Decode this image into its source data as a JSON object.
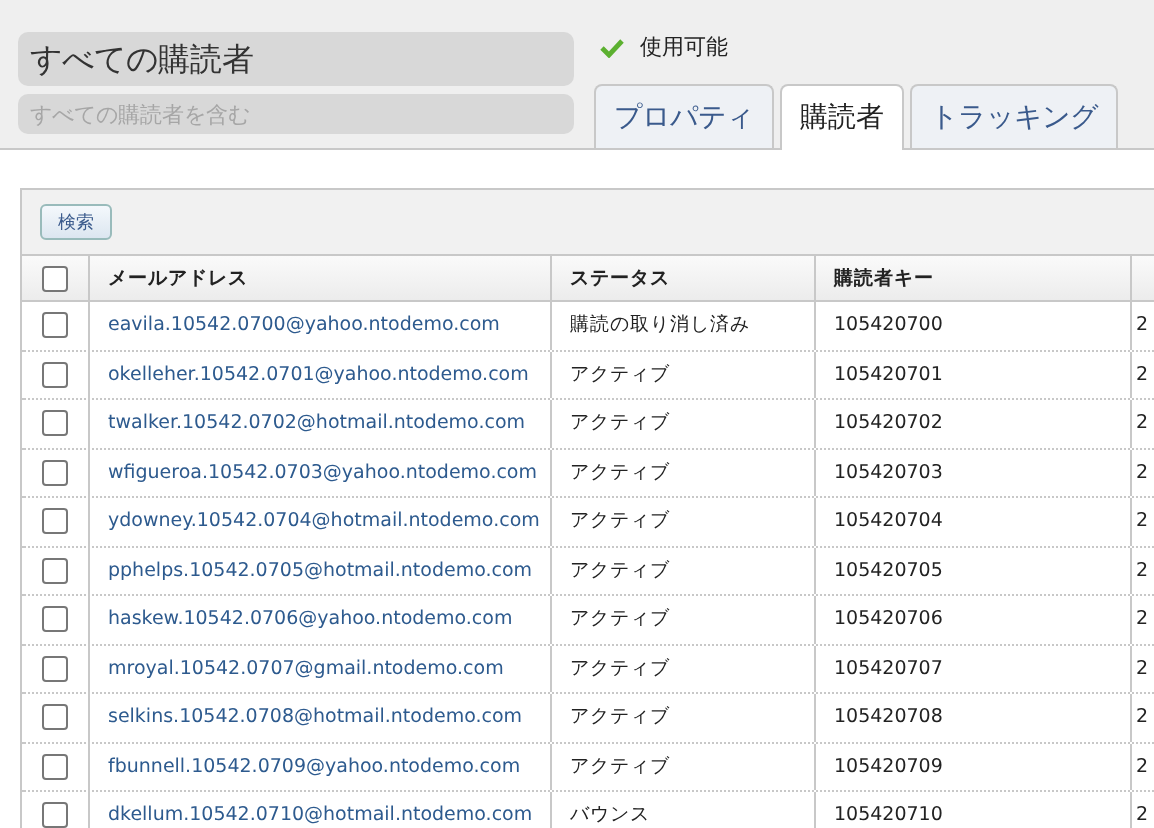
{
  "header": {
    "title": "すべての購読者",
    "description_placeholder": "すべての購読者を含む",
    "status": {
      "label": "使用可能",
      "checked": true
    }
  },
  "tabs": [
    {
      "label": "プロパティ",
      "selected": false
    },
    {
      "label": "購読者",
      "selected": true
    },
    {
      "label": "トラッキング",
      "selected": false
    }
  ],
  "toolbar": {
    "search_button": "検索"
  },
  "table": {
    "select_all": {
      "checked": false
    },
    "columns": [
      "メールアドレス",
      "ステータス",
      "購読者キー"
    ],
    "rows": [
      {
        "checked": false,
        "email": "eavila.10542.0700@yahoo.ntodemo.com",
        "status": "購読の取り消し済み",
        "key": "105420700",
        "column_5": "2"
      },
      {
        "checked": false,
        "email": "okelleher.10542.0701@yahoo.ntodemo.com",
        "status": "アクティブ",
        "key": "105420701",
        "column_5": "2"
      },
      {
        "checked": false,
        "email": "twalker.10542.0702@hotmail.ntodemo.com",
        "status": "アクティブ",
        "key": "105420702",
        "column_5": "2"
      },
      {
        "checked": false,
        "email": "wfigueroa.10542.0703@yahoo.ntodemo.com",
        "status": "アクティブ",
        "key": "105420703",
        "column_5": "2"
      },
      {
        "checked": false,
        "email": "ydowney.10542.0704@hotmail.ntodemo.com",
        "status": "アクティブ",
        "key": "105420704",
        "column_5": "2"
      },
      {
        "checked": false,
        "email": "pphelps.10542.0705@hotmail.ntodemo.com",
        "status": "アクティブ",
        "key": "105420705",
        "column_5": "2"
      },
      {
        "checked": false,
        "email": "haskew.10542.0706@yahoo.ntodemo.com",
        "status": "アクティブ",
        "key": "105420706",
        "column_5": "2"
      },
      {
        "checked": false,
        "email": "mroyal.10542.0707@gmail.ntodemo.com",
        "status": "アクティブ",
        "key": "105420707",
        "column_5": "2"
      },
      {
        "checked": false,
        "email": "selkins.10542.0708@hotmail.ntodemo.com",
        "status": "アクティブ",
        "key": "105420708",
        "column_5": "2"
      },
      {
        "checked": false,
        "email": "fbunnell.10542.0709@yahoo.ntodemo.com",
        "status": "アクティブ",
        "key": "105420709",
        "column_5": "2"
      },
      {
        "checked": false,
        "email": "dkellum.10542.0710@hotmail.ntodemo.com",
        "status": "バウンス",
        "key": "105420710",
        "column_5": "2"
      }
    ]
  }
}
